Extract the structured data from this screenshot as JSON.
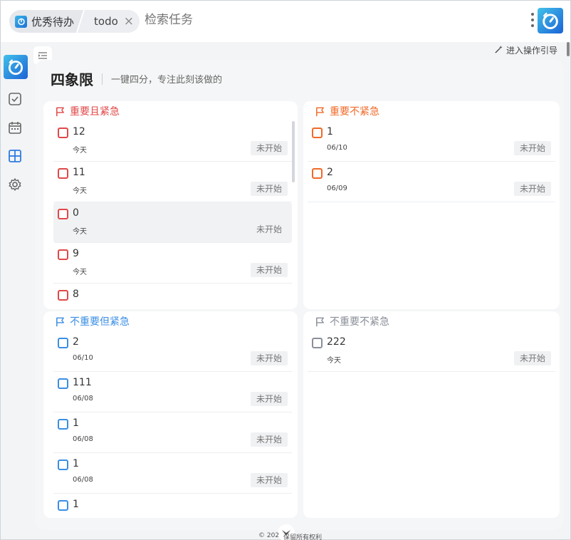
{
  "tabs": {
    "app_label": "优秀待办",
    "todo_label": "todo"
  },
  "search": {
    "placeholder": "检索任务"
  },
  "icons": {
    "app_logo": "timer-logo-icon",
    "close": "close-icon",
    "more": "more-vertical-icon",
    "collapse": "collapse-sidebar-icon",
    "guide": "magic-wand-icon",
    "flag": "flag-icon"
  },
  "guide_link": "进入操作引导",
  "header": {
    "title": "四象限",
    "subtitle": "一键四分，专注此刻该做的"
  },
  "colors": {
    "urgent_important": "#e04848",
    "important": "#f06a28",
    "urgent": "#3b8ee3",
    "neither": "#8a8f98"
  },
  "quadrants": [
    {
      "title": "重要且紧急",
      "color": "#e04848",
      "tasks": [
        {
          "name": "12",
          "date": "今天",
          "status": "未开始"
        },
        {
          "name": "11",
          "date": "今天",
          "status": "未开始"
        },
        {
          "name": "0",
          "date": "今天",
          "status": "未开始"
        },
        {
          "name": "9",
          "date": "今天",
          "status": "未开始"
        },
        {
          "name": "8",
          "date": "",
          "status": ""
        }
      ]
    },
    {
      "title": "重要不紧急",
      "color": "#f06a28",
      "tasks": [
        {
          "name": "1",
          "date": "06/10",
          "status": "未开始"
        },
        {
          "name": "2",
          "date": "06/09",
          "status": "未开始"
        }
      ]
    },
    {
      "title": "不重要但紧急",
      "color": "#3b8ee3",
      "tasks": [
        {
          "name": "2",
          "date": "06/10",
          "status": "未开始"
        },
        {
          "name": "111",
          "date": "06/08",
          "status": "未开始"
        },
        {
          "name": "1",
          "date": "06/08",
          "status": "未开始"
        },
        {
          "name": "1",
          "date": "06/08",
          "status": "未开始"
        },
        {
          "name": "1",
          "date": "",
          "status": ""
        }
      ]
    },
    {
      "title": "不重要不紧急",
      "color": "#8a8f98",
      "tasks": [
        {
          "name": "222",
          "date": "今天",
          "status": "未开始"
        }
      ]
    }
  ],
  "footer": {
    "copyright": "© 202",
    "rights": "保留所有权利"
  }
}
